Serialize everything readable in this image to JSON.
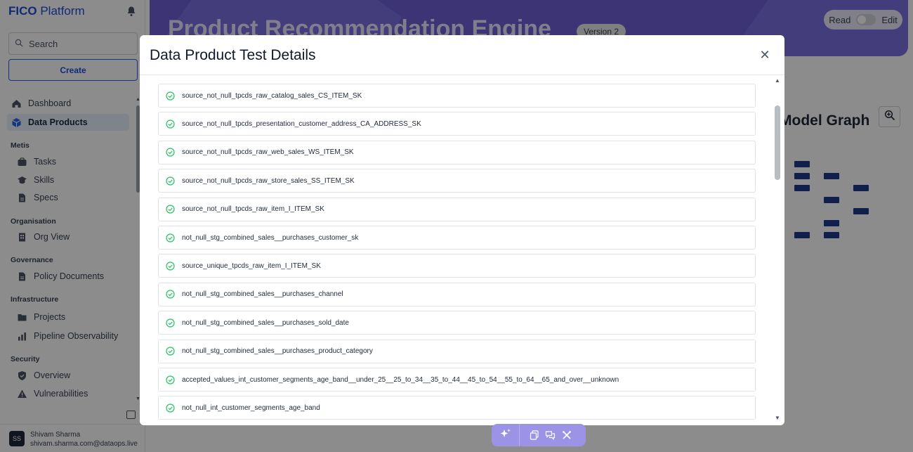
{
  "app": {
    "brand_bold": "FICO",
    "brand_rest": " Platform"
  },
  "sidebar": {
    "search_placeholder": "Search",
    "create_label": "Create",
    "items": [
      {
        "label": "Dashboard",
        "icon": "home-icon"
      },
      {
        "label": "Data Products",
        "icon": "cube-icon",
        "active": true
      }
    ],
    "sections": [
      {
        "title": "Metis",
        "items": [
          {
            "label": "Tasks",
            "icon": "tasks-icon"
          },
          {
            "label": "Skills",
            "icon": "graduation-cap-icon"
          },
          {
            "label": "Specs",
            "icon": "document-icon"
          }
        ]
      },
      {
        "title": "Organisation",
        "items": [
          {
            "label": "Org View",
            "icon": "building-icon"
          }
        ]
      },
      {
        "title": "Governance",
        "items": [
          {
            "label": "Policy Documents",
            "icon": "document-icon"
          }
        ]
      },
      {
        "title": "Infrastructure",
        "items": [
          {
            "label": "Projects",
            "icon": "folder-icon"
          },
          {
            "label": "Pipeline Observability",
            "icon": "bar-chart-icon"
          }
        ]
      },
      {
        "title": "Security",
        "items": [
          {
            "label": "Overview",
            "icon": "shield-icon"
          },
          {
            "label": "Vulnerabilities",
            "icon": "warning-icon"
          }
        ]
      }
    ],
    "user": {
      "initials": "SS",
      "name": "Shivam Sharma",
      "email": "shivam.sharma.com@dataops.live"
    }
  },
  "header": {
    "title": "Product Recommendation Engine",
    "version": "Version 2",
    "read_label": "Read",
    "edit_label": "Edit"
  },
  "graph": {
    "title": "Model Graph"
  },
  "modal": {
    "title": "Data Product Test Details",
    "tests": [
      {
        "name": "source_not_null_tpcds_raw_catalog_sales_CS_ITEM_SK",
        "status": "passed"
      },
      {
        "name": "source_not_null_tpcds_presentation_customer_address_CA_ADDRESS_SK",
        "status": "passed"
      },
      {
        "name": "source_not_null_tpcds_raw_web_sales_WS_ITEM_SK",
        "status": "passed"
      },
      {
        "name": "source_not_null_tpcds_raw_store_sales_SS_ITEM_SK",
        "status": "passed"
      },
      {
        "name": "source_not_null_tpcds_raw_item_I_ITEM_SK",
        "status": "passed"
      },
      {
        "name": "not_null_stg_combined_sales__purchases_customer_sk",
        "status": "passed"
      },
      {
        "name": "source_unique_tpcds_raw_item_I_ITEM_SK",
        "status": "passed"
      },
      {
        "name": "not_null_stg_combined_sales__purchases_channel",
        "status": "passed"
      },
      {
        "name": "not_null_stg_combined_sales__purchases_sold_date",
        "status": "passed"
      },
      {
        "name": "not_null_stg_combined_sales__purchases_product_category",
        "status": "passed"
      },
      {
        "name": "accepted_values_int_customer_segments_age_band__under_25__25_to_34__35_to_44__45_to_54__55_to_64__65_and_over__unknown",
        "status": "passed"
      },
      {
        "name": "not_null_int_customer_segments_age_band",
        "status": "passed"
      }
    ]
  },
  "colors": {
    "accent": "#1d4ed8",
    "hero": "#6d5fd6",
    "pass": "#22c55e",
    "node": "#1e3a8a"
  }
}
